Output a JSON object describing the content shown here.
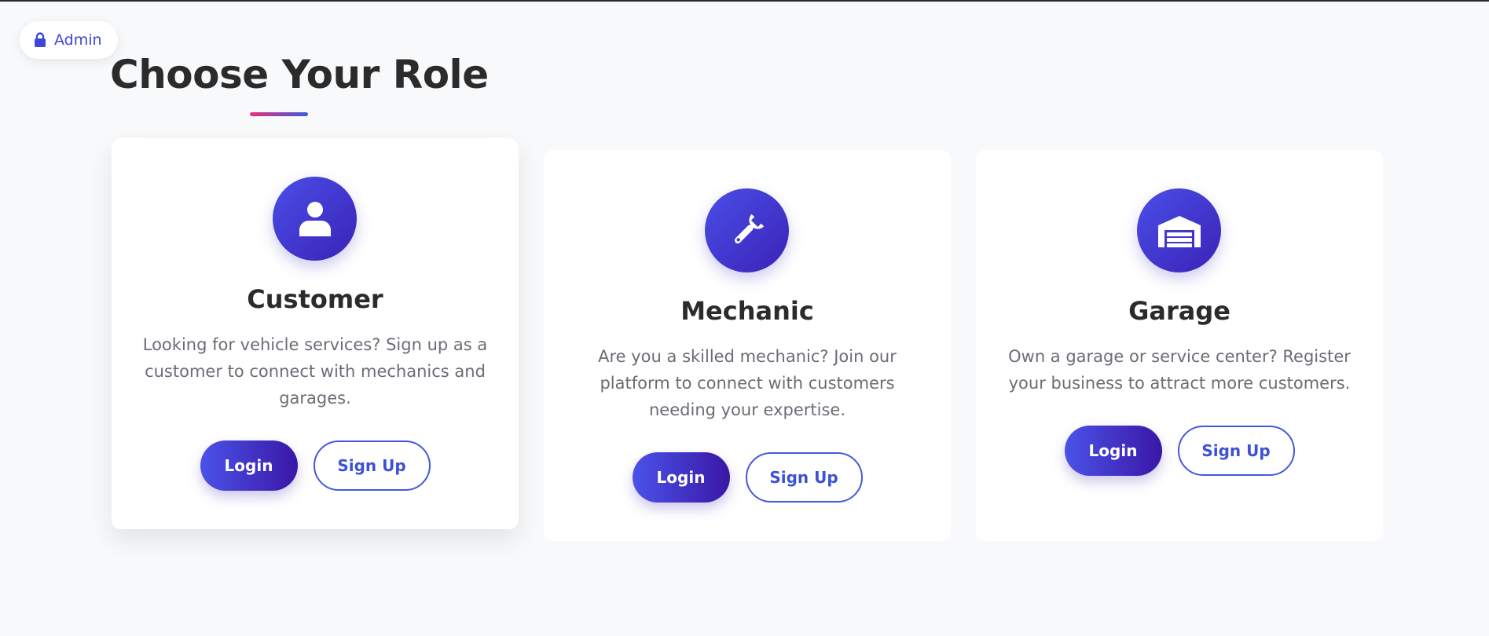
{
  "admin": {
    "label": "Admin",
    "icon": "lock-icon"
  },
  "page": {
    "title": "Choose Your Role"
  },
  "colors": {
    "accent": "#3f46d8",
    "gradient_start": "#4a4ee6",
    "gradient_end": "#3a23b8",
    "underline_start": "#e8307a",
    "underline_end": "#3d5bd9"
  },
  "roles": [
    {
      "title": "Customer",
      "icon": "user-icon",
      "description": "Looking for vehicle services? Sign up as a customer to connect with mechanics and garages.",
      "login_label": "Login",
      "signup_label": "Sign Up"
    },
    {
      "title": "Mechanic",
      "icon": "wrench-icon",
      "description": "Are you a skilled mechanic? Join our platform to connect with customers needing your expertise.",
      "login_label": "Login",
      "signup_label": "Sign Up"
    },
    {
      "title": "Garage",
      "icon": "warehouse-icon",
      "description": "Own a garage or service center? Register your business to attract more customers.",
      "login_label": "Login",
      "signup_label": "Sign Up"
    }
  ]
}
